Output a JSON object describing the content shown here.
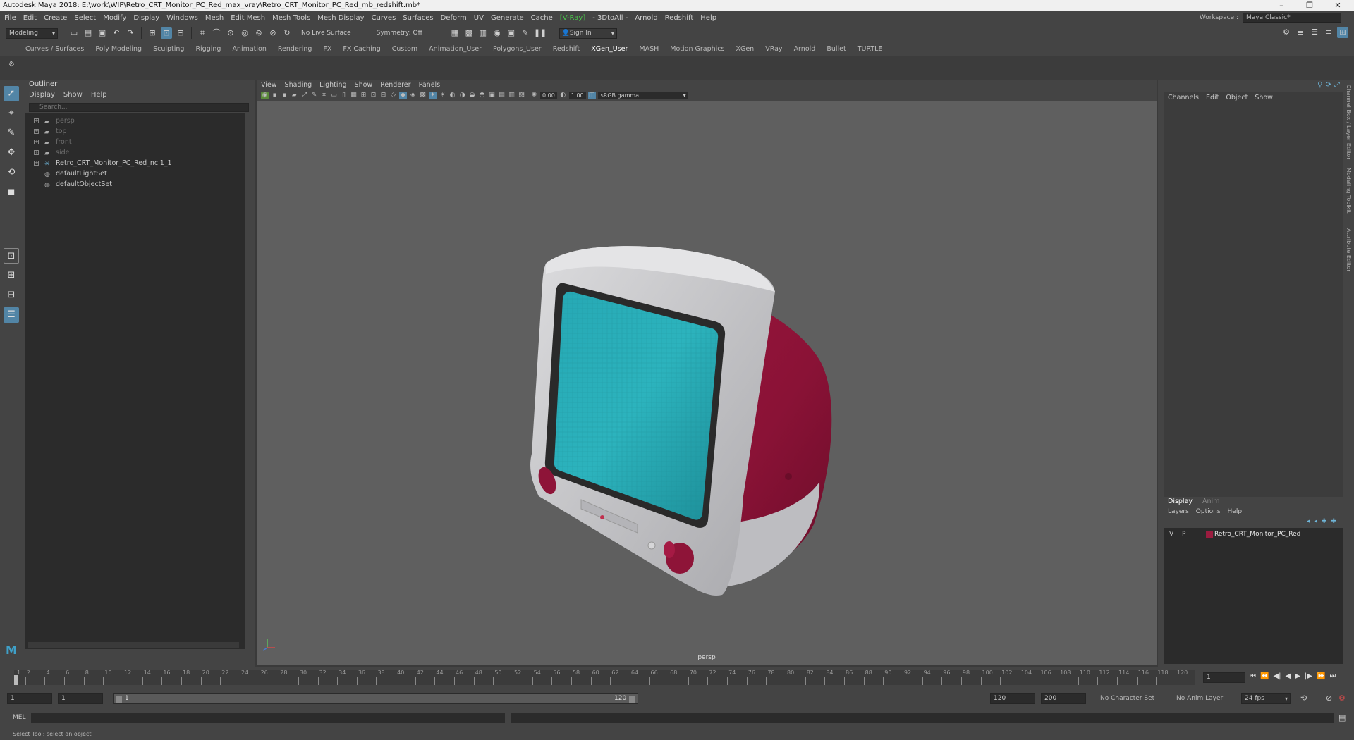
{
  "window": {
    "title": "Autodesk Maya 2018: E:\\work\\WIP\\Retro_CRT_Monitor_PC_Red_max_vray\\Retro_CRT_Monitor_PC_Red_mb_redshift.mb*",
    "controls": [
      "–",
      "❐",
      "✕"
    ]
  },
  "menubar": {
    "items": [
      "File",
      "Edit",
      "Create",
      "Select",
      "Modify",
      "Display",
      "Windows",
      "Mesh",
      "Edit Mesh",
      "Mesh Tools",
      "Mesh Display",
      "Curves",
      "Surfaces",
      "Deform",
      "UV",
      "Generate",
      "Cache",
      "V-Ray",
      "- 3DtoAll -",
      "Arnold",
      "Redshift",
      "Help"
    ],
    "workspace_label": "Workspace :",
    "workspace_value": "Maya Classic*"
  },
  "toolbar": {
    "mode": "Modeling",
    "live_surface": "No Live Surface",
    "symmetry": "Symmetry: Off",
    "sign_in": "Sign In"
  },
  "shelf": {
    "tabs": [
      "Curves / Surfaces",
      "Poly Modeling",
      "Sculpting",
      "Rigging",
      "Animation",
      "Rendering",
      "FX",
      "FX Caching",
      "Custom",
      "Animation_User",
      "Polygons_User",
      "Redshift",
      "XGen_User",
      "MASH",
      "Motion Graphics",
      "XGen",
      "VRay",
      "Arnold",
      "Bullet",
      "TURTLE"
    ],
    "active": "XGen_User"
  },
  "outliner": {
    "title": "Outliner",
    "menu": [
      "Display",
      "Show",
      "Help"
    ],
    "search_placeholder": "Search...",
    "items": [
      {
        "label": "persp",
        "type": "camera",
        "dim": true
      },
      {
        "label": "top",
        "type": "camera",
        "dim": true
      },
      {
        "label": "front",
        "type": "camera",
        "dim": true
      },
      {
        "label": "side",
        "type": "camera",
        "dim": true
      },
      {
        "label": "Retro_CRT_Monitor_PC_Red_ncl1_1",
        "type": "group",
        "dim": false
      },
      {
        "label": "defaultLightSet",
        "type": "set",
        "dim": false
      },
      {
        "label": "defaultObjectSet",
        "type": "set",
        "dim": false
      }
    ]
  },
  "viewport": {
    "menu": [
      "View",
      "Shading",
      "Lighting",
      "Show",
      "Renderer",
      "Panels"
    ],
    "exposure": "0.00",
    "gamma": "1.00",
    "color_space": "sRGB gamma",
    "camera_label": "persp"
  },
  "channel_box": {
    "menu": [
      "Channels",
      "Edit",
      "Object",
      "Show"
    ],
    "side_tabs": [
      "Channel Box / Layer Editor",
      "Modeling Toolkit",
      "Attribute Editor"
    ]
  },
  "layer_editor": {
    "tabs": [
      "Display",
      "Anim"
    ],
    "menu": [
      "Layers",
      "Options",
      "Help"
    ],
    "layer": {
      "v": "V",
      "p": "P",
      "name": "Retro_CRT_Monitor_PC_Red",
      "color": "#9b1c3f"
    }
  },
  "time_slider": {
    "ticks": [
      "1",
      "2",
      "4",
      "6",
      "8",
      "10",
      "12",
      "14",
      "16",
      "18",
      "20",
      "22",
      "24",
      "26",
      "28",
      "30",
      "32",
      "34",
      "36",
      "38",
      "40",
      "42",
      "44",
      "46",
      "48",
      "50",
      "52",
      "54",
      "56",
      "58",
      "60",
      "62",
      "64",
      "66",
      "68",
      "70",
      "72",
      "74",
      "76",
      "78",
      "80",
      "82",
      "84",
      "86",
      "88",
      "90",
      "92",
      "94",
      "96",
      "98",
      "100",
      "102",
      "104",
      "106",
      "108",
      "110",
      "112",
      "114",
      "116",
      "118",
      "120"
    ],
    "current_frame": "1"
  },
  "range": {
    "start": "1",
    "inner_start": "1",
    "bar_start": "1",
    "bar_end": "120",
    "inner_end": "120",
    "end": "200",
    "character_set": "No Character Set",
    "anim_layer": "No Anim Layer",
    "fps": "24 fps"
  },
  "command": {
    "label": "MEL",
    "help": "Select Tool: select an object"
  },
  "colors": {
    "accent": "#5285a6",
    "screen": "#2fa7b2",
    "case_red": "#8e1438",
    "case_white": "#c9c9cc"
  }
}
